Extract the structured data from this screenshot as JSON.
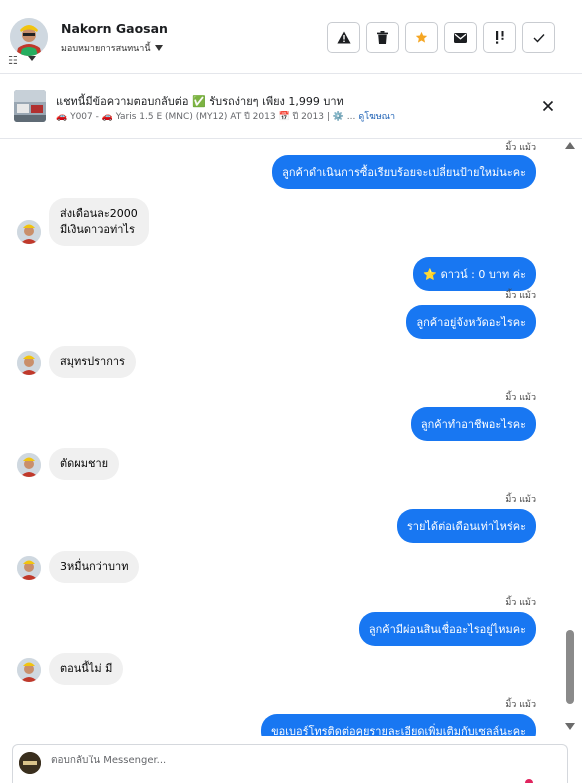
{
  "header": {
    "user_name": "Nakorn Gaosan",
    "assign_label": "มอบหมายการสนทนานี้",
    "actions": [
      {
        "icon": "warning-icon",
        "label": "spam"
      },
      {
        "icon": "trash-icon",
        "label": "delete"
      },
      {
        "icon": "star-icon",
        "label": "star"
      },
      {
        "icon": "mail-icon",
        "label": "mark unread"
      },
      {
        "icon": "follow-up-icon",
        "label": "follow up"
      },
      {
        "icon": "check-icon",
        "label": "done"
      }
    ],
    "star_color": "#f5a623"
  },
  "banner": {
    "title": "แชทนี้มีข้อความตอบกลับต่อ ✅ รับรถง่ายๆ เพียง 1,999 บาท",
    "sub_prefix": "🚗 Y007 - 🚗 Yaris 1.5 E (MNC) (MY12) AT ปี 2013 📅 ปี 2013 | ⚙️ ...",
    "link": "ดูโฆษณา"
  },
  "messages": {
    "out1_sender": "มิ้ว แม้ว",
    "out1_text": "ลูกค้าดำเนินการซื้อเรียบร้อยจะเปลี่ยนป้ายใหม่นะคะ",
    "in1_line1": "ส่งเดือนละ2000",
    "in1_line2": "มีเงินดาวอท่าไร",
    "out2_text": "⭐ ดาวน์ : 0 บาท  ค่ะ",
    "out3_sender": "มิ้ว แม้ว",
    "out3_text": "ลูกค้าอยู่จังหวัดอะไรคะ",
    "in2_text": "สมุทรปราการ",
    "out4_sender": "มิ้ว แม้ว",
    "out4_text": "ลูกค้าทำอาชีพอะไรคะ",
    "in3_text": "ตัดผมชาย",
    "out5_sender": "มิ้ว แม้ว",
    "out5_text": "รายได้ต่อเดือนเท่าไหร่คะ",
    "in4_text": "3หมื่นกว่าบาท",
    "out6_sender": "มิ้ว แม้ว",
    "out6_text": "ลูกค้ามีผ่อนสินเชื่ออะไรอยู่ไหมคะ",
    "in5_text": "ตอนนี้ไม่ มี",
    "out7_sender": "มิ้ว แม้ว",
    "out7_text": "ขอเบอร์โทรติดต่อคุยรายละเอียดเพิ่มเติมกับเซลล์นะคะ"
  },
  "composer": {
    "placeholder": "ตอบกลับใน Messenger..."
  },
  "colors": {
    "outgoing_bubble": "#1877f2",
    "incoming_bubble": "#f0f0f0"
  }
}
